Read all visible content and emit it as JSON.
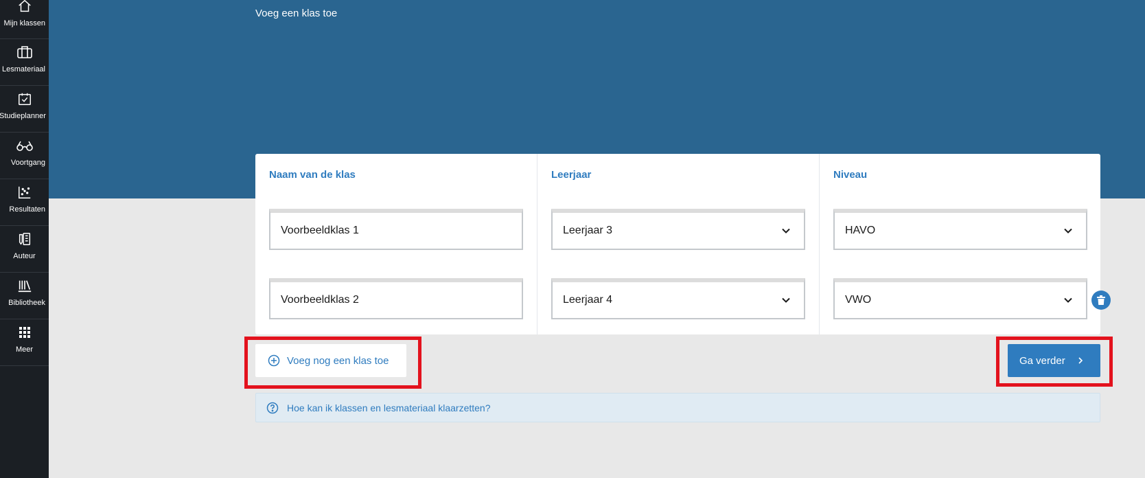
{
  "sidebar": {
    "items": [
      {
        "label": "Mijn klassen",
        "icon": "home-icon"
      },
      {
        "label": "Lesmateriaal",
        "icon": "briefcase-icon"
      },
      {
        "label": "Studieplanner",
        "icon": "calendar-check-icon"
      },
      {
        "label": "Voortgang",
        "icon": "glasses-icon"
      },
      {
        "label": "Resultaten",
        "icon": "scatter-chart-icon"
      },
      {
        "label": "Auteur",
        "icon": "author-icon"
      },
      {
        "label": "Bibliotheek",
        "icon": "library-icon"
      },
      {
        "label": "Meer",
        "icon": "grid-icon"
      }
    ]
  },
  "header": {
    "title": "Voeg een klas toe"
  },
  "form": {
    "columns": {
      "name": "Naam van de klas",
      "year": "Leerjaar",
      "level": "Niveau"
    },
    "rows": [
      {
        "name": "Voorbeeldklas 1",
        "year": "Leerjaar 3",
        "level": "HAVO"
      },
      {
        "name": "Voorbeeldklas 2",
        "year": "Leerjaar 4",
        "level": "VWO"
      }
    ]
  },
  "actions": {
    "add_class": "Voeg nog een klas toe",
    "continue": "Ga verder"
  },
  "help": {
    "text": "Hoe kan ik klassen en lesmateriaal klaarzetten?"
  },
  "colors": {
    "sidebar": "#1b1f24",
    "header": "#2a6590",
    "accent": "#2f7cbf",
    "highlight": "#e3121d",
    "help_bg": "#e0ebf3"
  }
}
